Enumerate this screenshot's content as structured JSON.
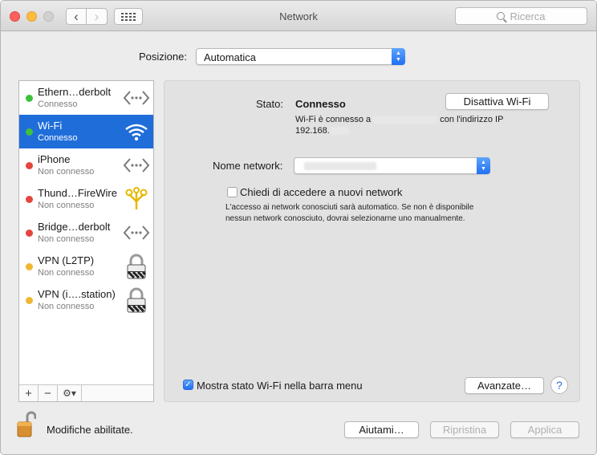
{
  "window": {
    "title": "Network"
  },
  "toolbar": {
    "search_placeholder": "Ricerca",
    "back": "‹",
    "forward": "›"
  },
  "location": {
    "label": "Posizione:",
    "value": "Automatica"
  },
  "services": [
    {
      "name": "Ethern…derbolt",
      "status": "Connesso",
      "dot_color": "#3ec23c",
      "icon": "ethernet-arrows-icon",
      "selected": false
    },
    {
      "name": "Wi-Fi",
      "status": "Connesso",
      "dot_color": "#3ec23c",
      "icon": "wifi-icon",
      "selected": true
    },
    {
      "name": "iPhone",
      "status": "Non connesso",
      "dot_color": "#e5453e",
      "icon": "ethernet-arrows-icon",
      "selected": false
    },
    {
      "name": "Thund…FireWire",
      "status": "Non connesso",
      "dot_color": "#e5453e",
      "icon": "firewire-icon",
      "selected": false
    },
    {
      "name": "Bridge…derbolt",
      "status": "Non connesso",
      "dot_color": "#e5453e",
      "icon": "ethernet-arrows-icon",
      "selected": false
    },
    {
      "name": "VPN (L2TP)",
      "status": "Non connesso",
      "dot_color": "#f0b731",
      "icon": "vpn-lock-icon",
      "selected": false
    },
    {
      "name": "VPN (i….station)",
      "status": "Non connesso",
      "dot_color": "#f0b731",
      "icon": "vpn-lock-icon",
      "selected": false
    }
  ],
  "sidebar_buttons": {
    "add": "+",
    "remove": "−",
    "action": "⚙▾"
  },
  "detail": {
    "status_label": "Stato:",
    "status_value": "Connesso",
    "toggle_button": "Disattiva Wi-Fi",
    "info_prefix": "Wi-Fi è connesso a",
    "info_suffix": "con l'indirizzo IP",
    "ip_prefix": "192.168.",
    "network_label": "Nome network:",
    "ask_label": "Chiedi di accedere a nuovi network",
    "ask_checked": false,
    "ask_description": "L'accesso ai network conosciuti sarà automatico. Se non è disponibile nessun network conosciuto, dovrai selezionarne uno manualmente.",
    "menu_label": "Mostra stato Wi-Fi nella barra menu",
    "menu_checked": true,
    "advanced_button": "Avanzate…",
    "help": "?"
  },
  "footer": {
    "lock_text": "Modifiche abilitate.",
    "help_button": "Aiutami…",
    "revert_button": "Ripristina",
    "apply_button": "Applica"
  },
  "colors": {
    "selection": "#1f6dd9",
    "accent": "#2f7bf6"
  }
}
